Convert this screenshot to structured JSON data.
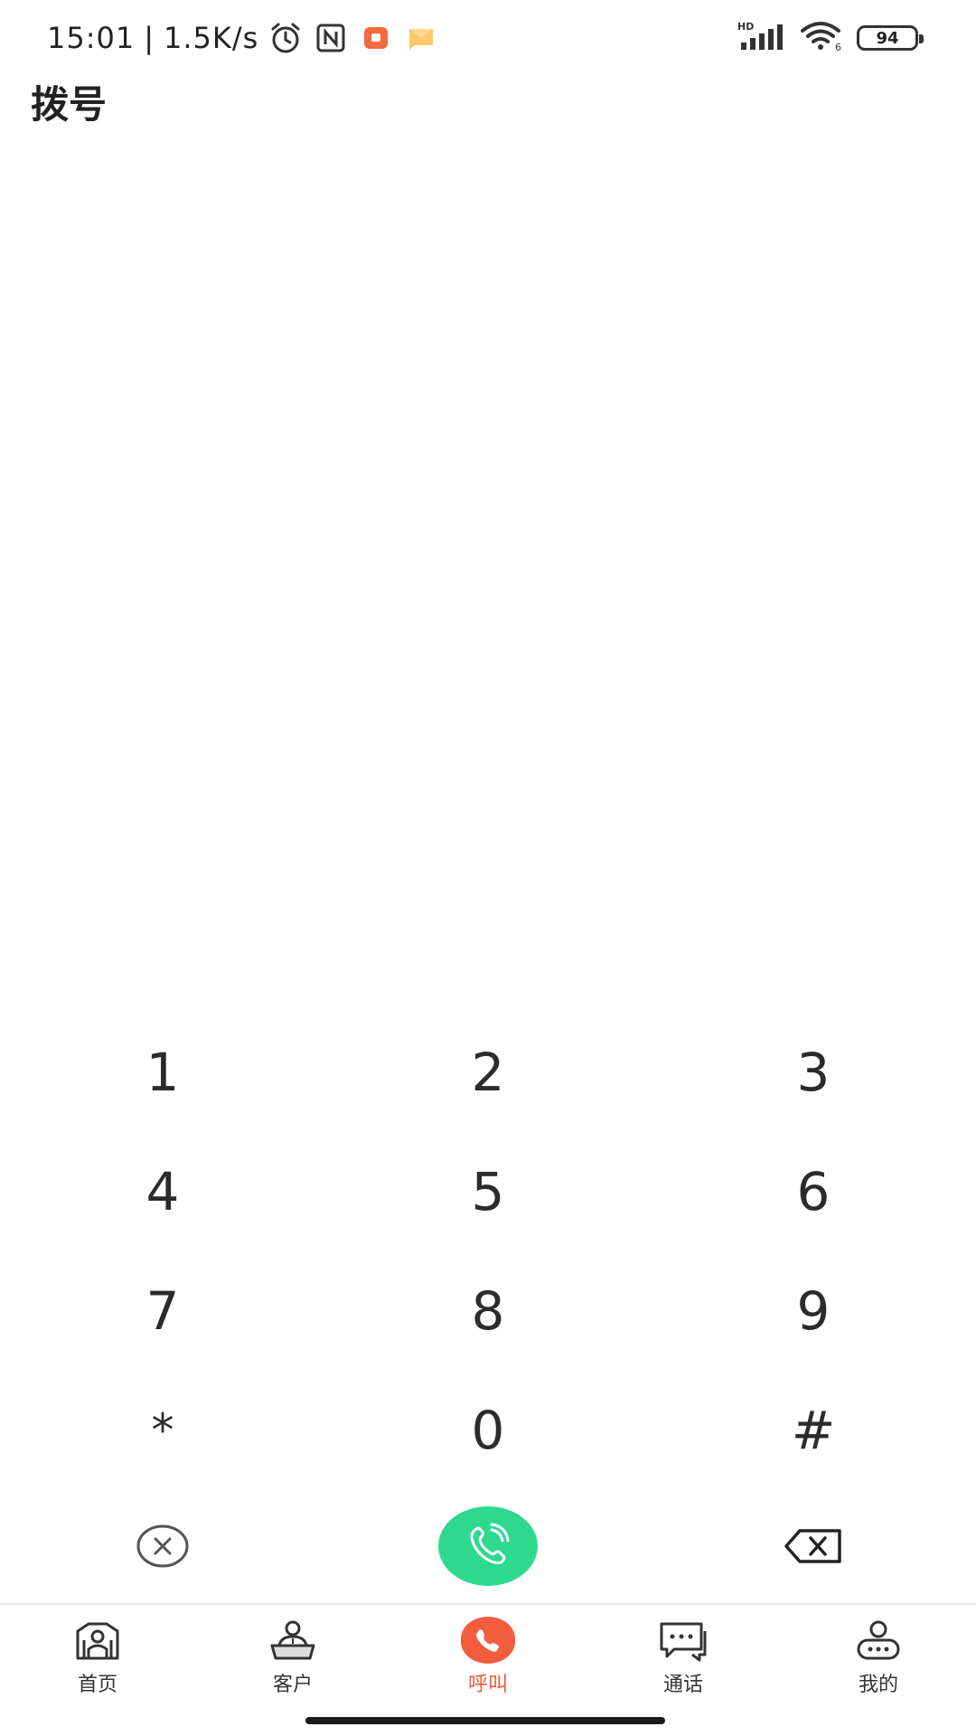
{
  "status_bar": {
    "time": "15:01",
    "net_speed": "1.5K/s",
    "battery": "94"
  },
  "header": {
    "title": "拨号"
  },
  "keypad": {
    "rows": [
      [
        "1",
        "2",
        "3"
      ],
      [
        "4",
        "5",
        "6"
      ],
      [
        "7",
        "8",
        "9"
      ],
      [
        "*",
        "0",
        "#"
      ]
    ]
  },
  "colors": {
    "call_green": "#2ed98e",
    "accent_orange": "#f25c3f"
  },
  "bottom_nav": {
    "items": [
      {
        "label": "首页",
        "icon": "home-icon",
        "active": false
      },
      {
        "label": "客户",
        "icon": "customer-icon",
        "active": false
      },
      {
        "label": "呼叫",
        "icon": "phone-icon",
        "active": true
      },
      {
        "label": "通话",
        "icon": "chat-icon",
        "active": false
      },
      {
        "label": "我的",
        "icon": "profile-icon",
        "active": false
      }
    ]
  }
}
